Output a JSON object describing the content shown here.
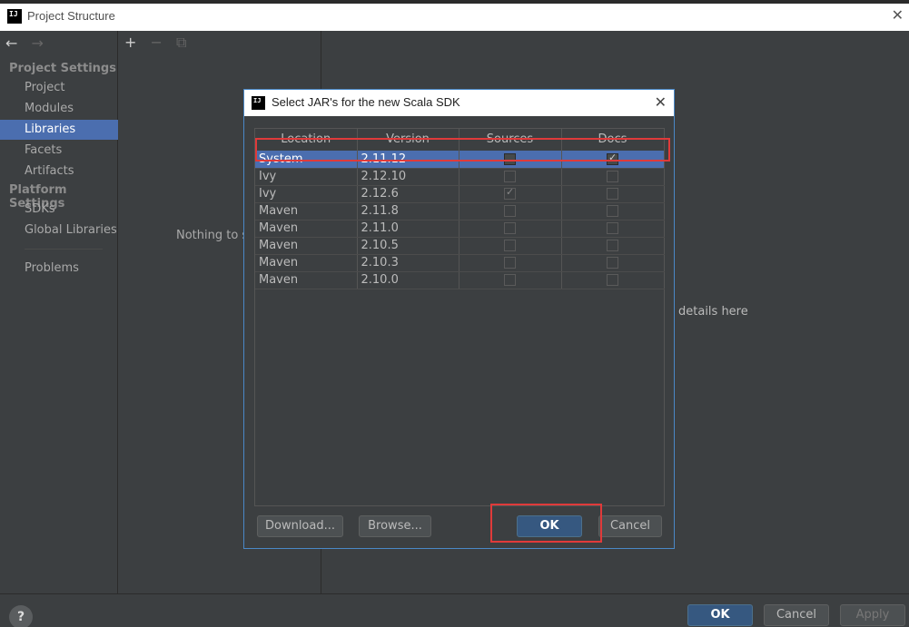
{
  "window": {
    "title": "Project Structure",
    "logo": "IJ"
  },
  "nav": {
    "back_icon": "←",
    "forward_icon": "→"
  },
  "sidebar": {
    "group1": "Project Settings",
    "items1": [
      "Project",
      "Modules",
      "Libraries",
      "Facets",
      "Artifacts"
    ],
    "group2": "Platform Settings",
    "items2": [
      "SDKs",
      "Global Libraries"
    ],
    "problems": "Problems",
    "selected": "Libraries"
  },
  "middle": {
    "add_icon": "+",
    "remove_icon": "−",
    "copy_icon": "⧉",
    "empty_text": "Nothing to s"
  },
  "right": {
    "hint_text": "details here"
  },
  "bottom": {
    "help": "?",
    "ok": "OK",
    "cancel": "Cancel",
    "apply": "Apply"
  },
  "dialog": {
    "title": "Select JAR's for the new Scala SDK",
    "logo": "IJ",
    "columns": [
      "Location",
      "Version",
      "Sources",
      "Docs"
    ],
    "rows": [
      {
        "location": "System",
        "version": "2.11.12",
        "sources": false,
        "docs": true
      },
      {
        "location": "Ivy",
        "version": "2.12.10",
        "sources": false,
        "docs": false
      },
      {
        "location": "Ivy",
        "version": "2.12.6",
        "sources": true,
        "docs": false
      },
      {
        "location": "Maven",
        "version": "2.11.8",
        "sources": false,
        "docs": false
      },
      {
        "location": "Maven",
        "version": "2.11.0",
        "sources": false,
        "docs": false
      },
      {
        "location": "Maven",
        "version": "2.10.5",
        "sources": false,
        "docs": false
      },
      {
        "location": "Maven",
        "version": "2.10.3",
        "sources": false,
        "docs": false
      },
      {
        "location": "Maven",
        "version": "2.10.0",
        "sources": false,
        "docs": false
      }
    ],
    "selected_row": 0,
    "buttons": {
      "download": "Download...",
      "browse": "Browse...",
      "ok": "OK",
      "cancel": "Cancel"
    }
  },
  "colors": {
    "accent": "#4b6eaf",
    "highlight": "#e03a3a",
    "primary_button": "#365880"
  }
}
